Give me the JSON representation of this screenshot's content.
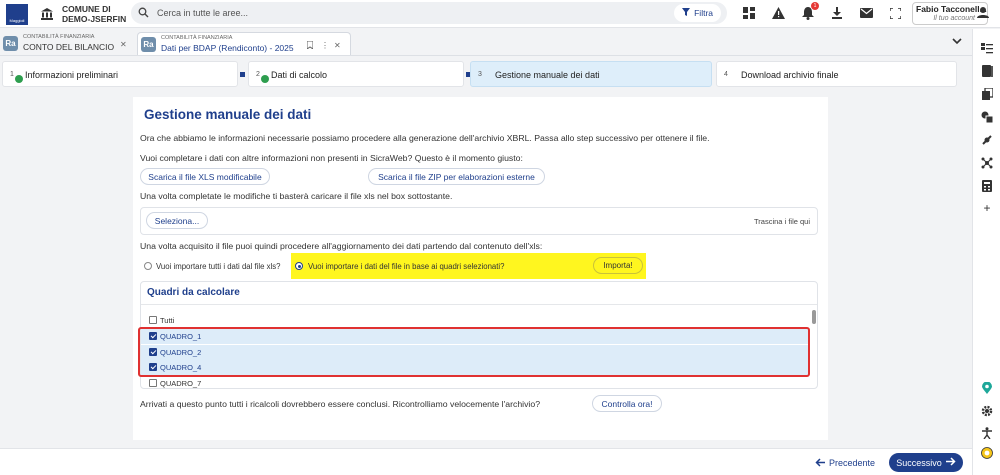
{
  "header": {
    "org_line1": "COMUNE DI",
    "org_line2": "DEMO-JSERFIN",
    "search_placeholder": "Cerca in tutte le aree...",
    "filter_label": "Filtra",
    "notification_count": "1",
    "user_name": "Fabio Tacconell...",
    "user_account": "Il tuo account"
  },
  "tabs": [
    {
      "icon_text": "Ra",
      "module": "CONTABILITÀ FINANZIARIA",
      "title": "CONTO DEL BILANCIO"
    },
    {
      "icon_text": "Ra",
      "module": "CONTABILITÀ FINANZIARIA",
      "title": "Dati per BDAP (Rendiconto) - 2025"
    }
  ],
  "steps": [
    {
      "number": "1",
      "label": "Informazioni preliminari",
      "done": true
    },
    {
      "number": "2",
      "label": "Dati di calcolo",
      "done": true
    },
    {
      "number": "3",
      "label": "Gestione manuale dei dati",
      "active": true
    },
    {
      "number": "4",
      "label": "Download archivio finale"
    }
  ],
  "content": {
    "title": "Gestione manuale dei dati",
    "intro": "Ora che abbiamo le informazioni necessarie possiamo procedere alla generazione dell'archivio XBRL. Passa allo step successivo per ottenere il file.",
    "complete_prompt": "Vuoi completare i dati con altre informazioni non presenti in SicraWeb? Questo è il momento giusto:",
    "download_xls": "Scarica il file XLS modificabile",
    "download_zip": "Scarica il file ZIP per elaborazioni esterne",
    "upload_text": "Una volta completate le modifiche ti basterà caricare il file xls nel box sottostante.",
    "select_button": "Seleziona...",
    "drop_hint": "Trascina i file qui",
    "update_text": "Una volta acquisito il file puoi quindi procedere all'aggiornamento dei dati partendo dal contenuto dell'xls:",
    "radio_all": "Vuoi importare tutti i dati dal file xls?",
    "radio_selected": "Vuoi importare i dati del file in base ai quadri selezionati?",
    "import_button": "Importa!",
    "quadri_title": "Quadri da calcolare",
    "quadri": [
      {
        "label": "Tutti",
        "checked": false
      },
      {
        "label": "QUADRO_1",
        "checked": true
      },
      {
        "label": "QUADRO_2",
        "checked": true
      },
      {
        "label": "QUADRO_4",
        "checked": true
      },
      {
        "label": "QUADRO_7",
        "checked": false
      }
    ],
    "final_text": "Arrivati a questo punto tutti i ricalcoli dovrebbero essere conclusi. Ricontrolliamo velocemente l'archivio?",
    "check_button": "Controlla ora!"
  },
  "footer": {
    "prev_label": "Precedente",
    "next_label": "Successivo"
  },
  "colors": {
    "brand": "#1f3f8c",
    "highlight": "#fff61f",
    "annotation_box": "#e03131",
    "selected_row": "#ddecf9",
    "active_step": "#deeefa"
  }
}
